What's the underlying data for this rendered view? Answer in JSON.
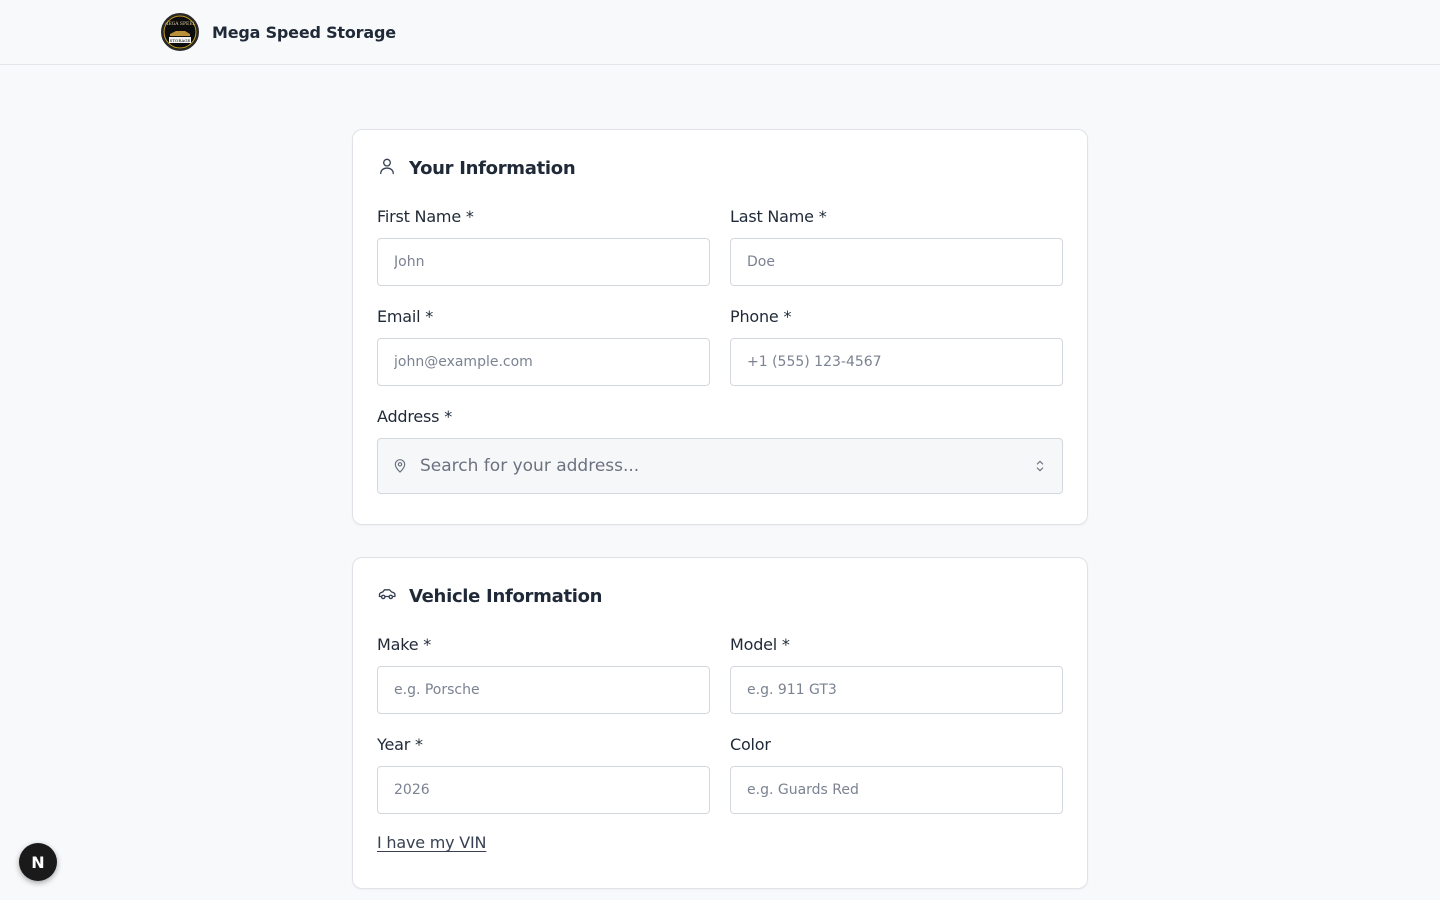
{
  "header": {
    "brand_name": "Mega Speed Storage",
    "logo_text": [
      "MEGA SPEED",
      "STORAGE"
    ]
  },
  "your_information": {
    "title": "Your Information",
    "icon": "user-icon",
    "first_name": {
      "label": "First Name *",
      "placeholder": "John",
      "value": ""
    },
    "last_name": {
      "label": "Last Name *",
      "placeholder": "Doe",
      "value": ""
    },
    "email": {
      "label": "Email *",
      "placeholder": "john@example.com",
      "value": ""
    },
    "phone": {
      "label": "Phone *",
      "placeholder": "+1 (555) 123-4567",
      "value": ""
    },
    "address": {
      "label": "Address *",
      "placeholder": "Search for your address...",
      "value": ""
    }
  },
  "vehicle_information": {
    "title": "Vehicle Information",
    "icon": "car-icon",
    "make": {
      "label": "Make *",
      "placeholder": "e.g. Porsche",
      "value": ""
    },
    "model": {
      "label": "Model *",
      "placeholder": "e.g. 911 GT3",
      "value": ""
    },
    "year": {
      "label": "Year *",
      "placeholder": "2026",
      "value": ""
    },
    "color": {
      "label": "Color",
      "placeholder": "e.g. Guards Red",
      "value": ""
    },
    "vin_link": "I have my VIN"
  },
  "dev_badge": {
    "letter": "N"
  },
  "colors": {
    "background": "#f8f9fb",
    "card": "#ffffff",
    "border": "#dfe2e7",
    "text": "#1f2937",
    "placeholder": "#7b8291"
  }
}
